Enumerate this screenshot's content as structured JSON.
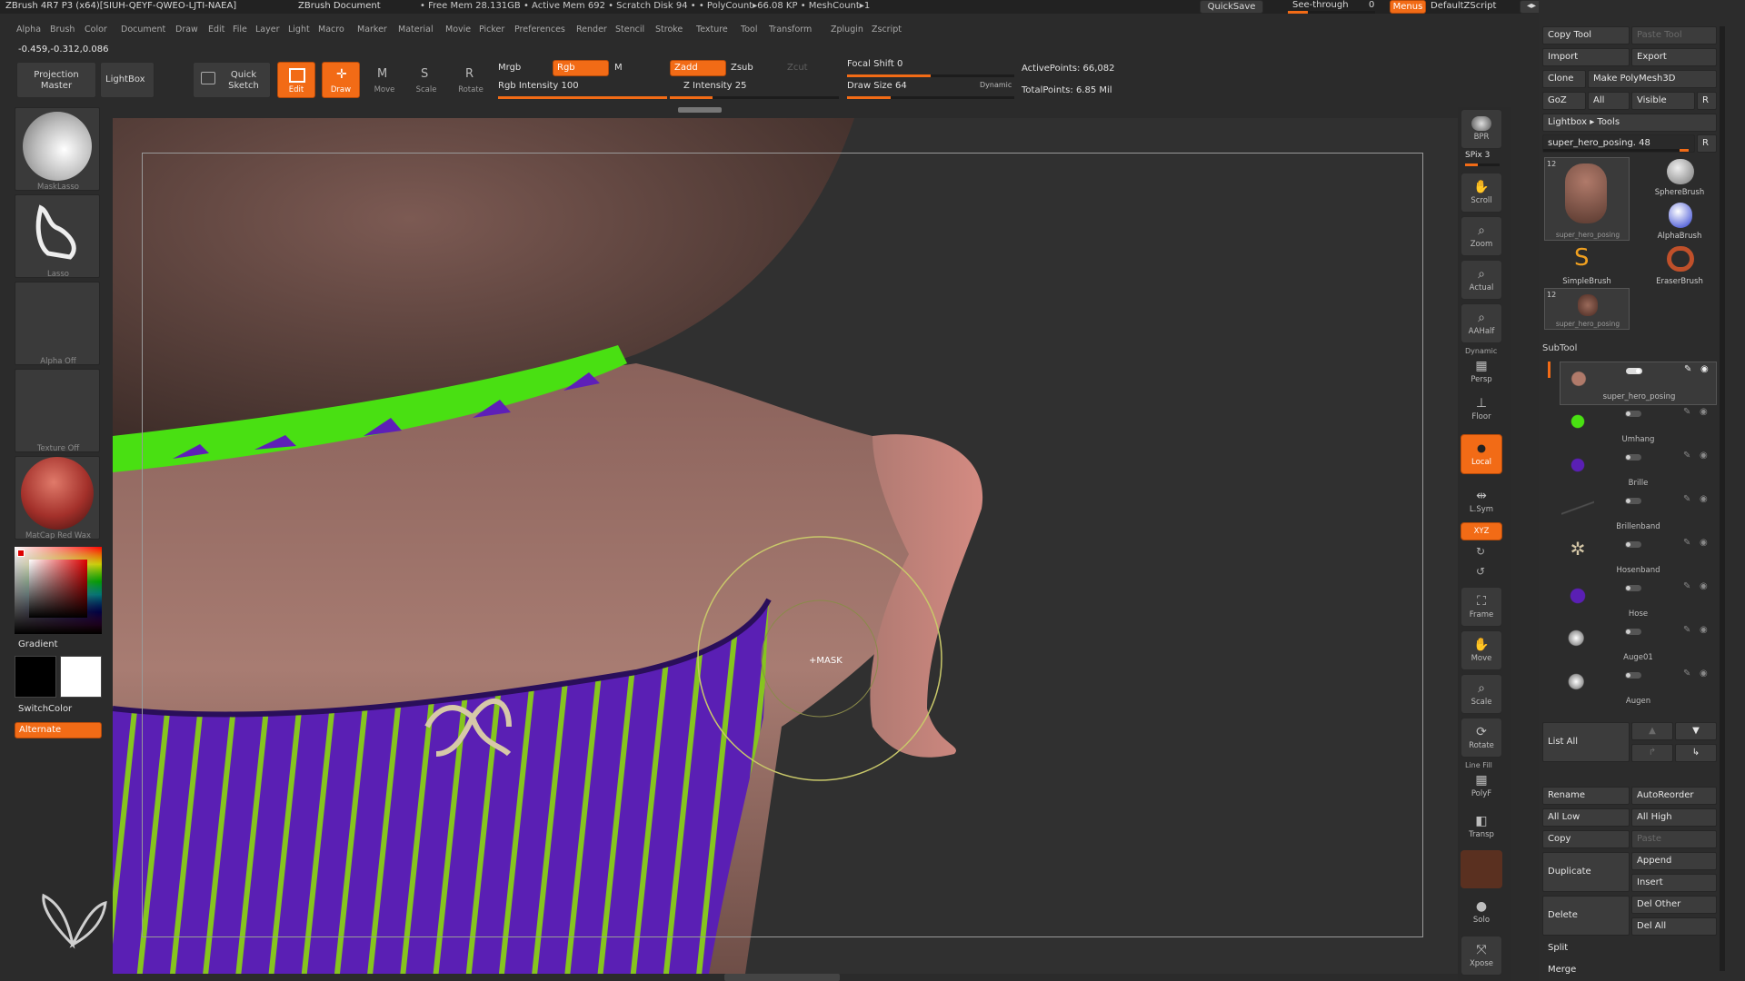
{
  "titlebar": {
    "app": "ZBrush 4R7 P3 (x64)[SIUH-QEYF-QWEO-LJTI-NAEA]",
    "document": "ZBrush Document",
    "stats": "• Free Mem 28.131GB • Active Mem 692 • Scratch Disk 94 • • PolyCount▸66.08 KP • MeshCount▸1",
    "quicksave": "QuickSave",
    "seethrough": "See-through",
    "seethrough_value": "0",
    "menus": "Menus",
    "script": "DefaultZScript"
  },
  "menubar": [
    "Alpha",
    "Brush",
    "Color",
    "Document",
    "Draw",
    "Edit",
    "File",
    "Layer",
    "Light",
    "Macro",
    "Marker",
    "Material",
    "Movie",
    "Picker",
    "Preferences",
    "Render",
    "Stencil",
    "Stroke",
    "Texture",
    "Tool",
    "Transform",
    "Zplugin",
    "Zscript"
  ],
  "coords": "-0.459,-0.312,0.086",
  "shelf": {
    "projection_master": "Projection Master",
    "lightbox": "LightBox",
    "quick_sketch": "Quick Sketch",
    "edit": "Edit",
    "draw": "Draw",
    "move": "Move",
    "scale": "Scale",
    "rotate": "Rotate",
    "mrgb": "Mrgb",
    "rgb": "Rgb",
    "m": "M",
    "rgb_intensity_label": "Rgb Intensity 100",
    "rgb_intensity": 1.0,
    "zadd": "Zadd",
    "zsub": "Zsub",
    "zcut": "Zcut",
    "z_intensity_label": "Z Intensity 25",
    "z_intensity": 0.25,
    "focal_shift_label": "Focal Shift 0",
    "draw_size_label": "Draw Size 64",
    "dynamic": "Dynamic",
    "active_points": "ActivePoints: 66,082",
    "total_points": "TotalPoints: 6.85 Mil"
  },
  "left": {
    "brush_caption": "MaskLasso",
    "stroke_caption": "Lasso",
    "alpha_caption": "Alpha Off",
    "texture_caption": "Texture Off",
    "material_caption": "MatCap Red Wax",
    "gradient": "Gradient",
    "switch_color": "SwitchColor",
    "alternate": "Alternate"
  },
  "viewport": {
    "cursor_label": "+MASK"
  },
  "righttools": [
    {
      "name": "bpr",
      "label": "BPR"
    },
    {
      "name": "scroll",
      "label": "Scroll"
    },
    {
      "name": "zoom",
      "label": "Zoom"
    },
    {
      "name": "actual",
      "label": "Actual"
    },
    {
      "name": "aahalf",
      "label": "AAHalf"
    },
    {
      "name": "persp",
      "label": "Persp"
    },
    {
      "name": "floor",
      "label": "Floor"
    },
    {
      "name": "local",
      "label": "Local"
    },
    {
      "name": "lsym",
      "label": "L.Sym"
    },
    {
      "name": "xyz",
      "label": "XYZ"
    },
    {
      "name": "frame",
      "label": "Frame"
    },
    {
      "name": "move",
      "label": "Move"
    },
    {
      "name": "scale",
      "label": "Scale"
    },
    {
      "name": "rotate",
      "label": "Rotate"
    },
    {
      "name": "polyf",
      "label": "PolyF"
    },
    {
      "name": "transp",
      "label": "Transp"
    },
    {
      "name": "solo",
      "label": "Solo"
    },
    {
      "name": "xpose",
      "label": "Xpose"
    }
  ],
  "spix": "SPix 3",
  "dynamic_label": "Dynamic",
  "linefill_label": "Line Fill",
  "tool": {
    "copy_tool": "Copy Tool",
    "paste_tool": "Paste Tool",
    "import": "Import",
    "export": "Export",
    "clone": "Clone",
    "make_polymesh": "Make PolyMesh3D",
    "goz": "GoZ",
    "all": "All",
    "visible": "Visible",
    "r": "R",
    "lightbox_tools": "Lightbox ▸ Tools",
    "current_tool": "super_hero_posing. 48",
    "tool_count_1": "12",
    "tool_count_2": "12",
    "thumb_1": "super_hero_posing",
    "thumb_2": "super_hero_posing",
    "sphere_brush": "SphereBrush",
    "alpha_brush": "AlphaBrush",
    "simple_brush": "SimpleBrush",
    "eraser_brush": "EraserBrush"
  },
  "subtool": {
    "title": "SubTool",
    "items": [
      "super_hero_posing",
      "Umhang",
      "Brille",
      "Brillenband",
      "Hosenband",
      "Hose",
      "Auge01",
      "Augen"
    ],
    "list_all": "List All",
    "rename": "Rename",
    "autoreorder": "AutoReorder",
    "all_low": "All Low",
    "all_high": "All High",
    "copy": "Copy",
    "paste": "Paste",
    "duplicate": "Duplicate",
    "append": "Append",
    "insert": "Insert",
    "delete": "Delete",
    "del_other": "Del Other",
    "del_all": "Del All",
    "split": "Split",
    "merge": "Merge"
  },
  "colors": {
    "accent": "#f26b16",
    "panel": "#2c2c2c",
    "button": "#3b3b3b",
    "skin": "#a8766c",
    "stripe_purple": "#5b1fb0",
    "stripe_green": "#7fc31c",
    "strap_green": "#49e012",
    "brush_ring": "#c9c86a"
  }
}
